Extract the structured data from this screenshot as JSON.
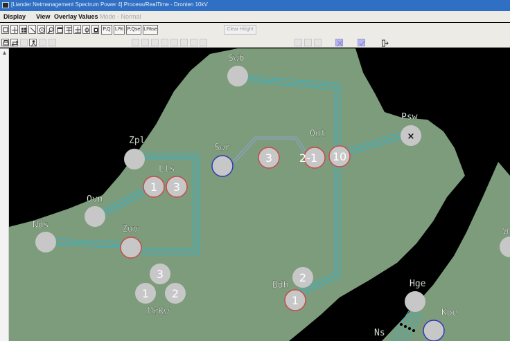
{
  "titlebar": {
    "text": "[Liander Netmanagement Spectrum Power 4] Process/RealTime - Dronten 10kV"
  },
  "menu": {
    "display": "Display",
    "view": "View",
    "overlay": "Overlay",
    "values": "Values",
    "mode": "Mode - Normal"
  },
  "toolbar": {
    "pq": "P,Q",
    "li_pct": "LI%",
    "pqse": "P,Qse",
    "li_pctse": "LI%se",
    "clear_hilight": "Clear Hilight"
  },
  "map": {
    "colors": {
      "land": "#7d9c7b",
      "water": "#000000",
      "cable": "#2fb5d1",
      "node_fill": "#c7c7c7",
      "node_red": "#c74a4a",
      "node_blue": "#2d39b8",
      "text": "#ffffff"
    },
    "labels": {
      "swb": "Swb",
      "psw": "Psw",
      "ont": "Ont",
      "zpl": "Zpl",
      "swr": "Swr",
      "lls": "Lls",
      "ovn": "Ovn",
      "nds": "Nds",
      "zuv": "Zuv",
      "bdh": "Bdh",
      "hge": "Hge",
      "koe": "Koe",
      "ns": "Ns",
      "mrkw": "MrKw",
      "w": "W"
    },
    "node_values": {
      "swr_right": "3",
      "ont_left": "2-1",
      "ont_right": "10",
      "lls_left": "1",
      "lls_right": "3",
      "psw": "×",
      "bdh_top": "2",
      "bdh_bottom": "1",
      "mrkw_top": "3",
      "mrkw_left": "1",
      "mrkw_right": "2"
    }
  }
}
